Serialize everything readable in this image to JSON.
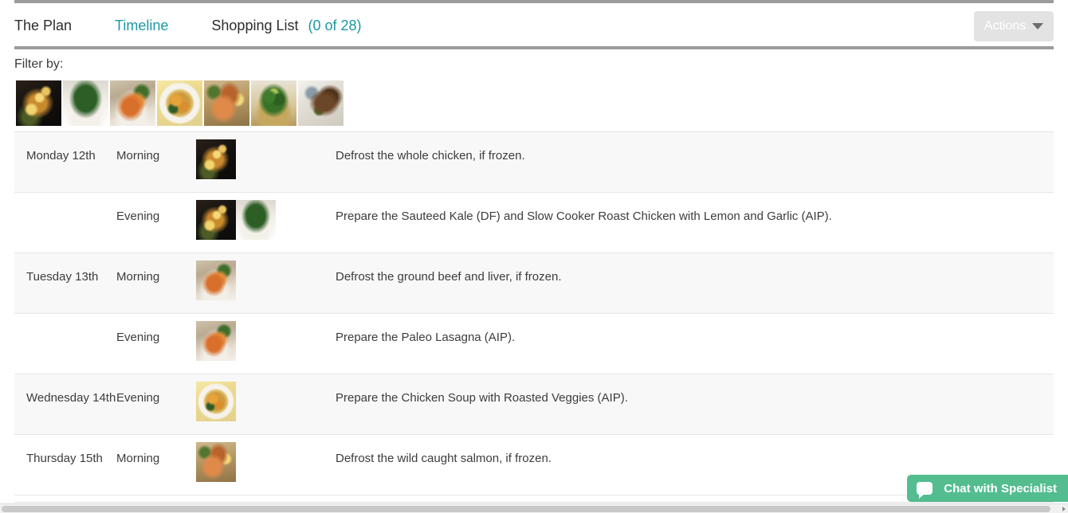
{
  "nav": {
    "plan_label": "The Plan",
    "timeline_label": "Timeline",
    "shopping_label": "Shopping List",
    "shopping_count": "(0 of 28)",
    "actions_label": "Actions",
    "accent_color": "#1c97a4"
  },
  "filter": {
    "label": "Filter by:",
    "thumbnails": [
      {
        "name": "slow-cooker-roast-chicken",
        "alt": "Slow Cooker Roast Chicken with Lemon and Garlic"
      },
      {
        "name": "sauteed-kale",
        "alt": "Sauteed Kale"
      },
      {
        "name": "paleo-lasagna",
        "alt": "Paleo Lasagna"
      },
      {
        "name": "chicken-soup-roasted-veggies",
        "alt": "Chicken Soup with Roasted Veggies"
      },
      {
        "name": "wild-caught-salmon",
        "alt": "Wild Caught Salmon"
      },
      {
        "name": "broccoli-bowl",
        "alt": "Broccoli"
      },
      {
        "name": "roast-meat-plate",
        "alt": "Roast Meat"
      }
    ]
  },
  "table": {
    "rows": [
      {
        "day": "Monday 12th",
        "time": "Morning",
        "description": "Defrost the whole chicken, if frozen.",
        "thumbs": [
          "slow-cooker-roast-chicken"
        ],
        "striped": true
      },
      {
        "day": "",
        "time": "Evening",
        "description": "Prepare the Sauteed Kale (DF) and Slow Cooker Roast Chicken with Lemon and Garlic (AIP).",
        "thumbs": [
          "slow-cooker-roast-chicken",
          "sauteed-kale"
        ],
        "striped": false
      },
      {
        "day": "Tuesday 13th",
        "time": "Morning",
        "description": "Defrost the ground beef and liver, if frozen.",
        "thumbs": [
          "paleo-lasagna"
        ],
        "striped": true
      },
      {
        "day": "",
        "time": "Evening",
        "description": "Prepare the Paleo Lasagna (AIP).",
        "thumbs": [
          "paleo-lasagna"
        ],
        "striped": false
      },
      {
        "day": "Wednesday 14th",
        "time": "Evening",
        "description": "Prepare the Chicken Soup with Roasted Veggies (AIP).",
        "thumbs": [
          "chicken-soup-roasted-veggies"
        ],
        "striped": true
      },
      {
        "day": "Thursday 15th",
        "time": "Morning",
        "description": "Defrost the wild caught salmon, if frozen.",
        "thumbs": [
          "wild-caught-salmon"
        ],
        "striped": false
      }
    ]
  },
  "chat": {
    "label": "Chat with Specialist",
    "icon": "speech-bubble-icon",
    "color": "#53bd8f"
  }
}
